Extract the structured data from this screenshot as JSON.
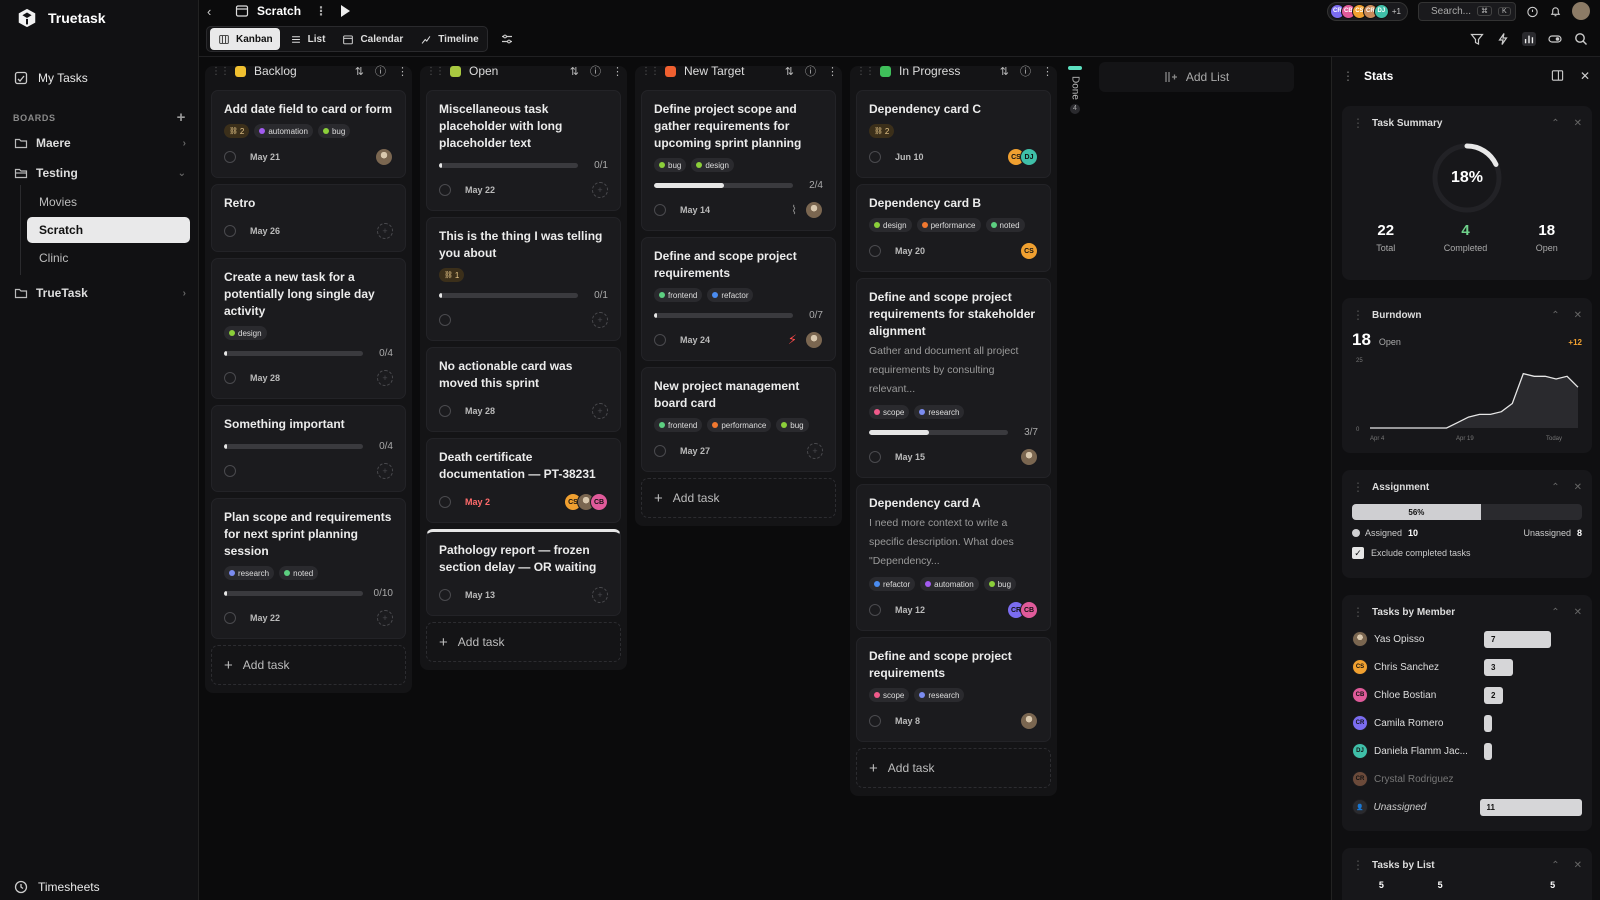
{
  "app": {
    "name": "Truetask"
  },
  "sidebar": {
    "my_tasks": "My Tasks",
    "boards_label": "BOARDS",
    "boards": [
      {
        "name": "Maere"
      },
      {
        "name": "Testing",
        "children": [
          "Movies",
          "Scratch",
          "Clinic"
        ]
      },
      {
        "name": "TrueTask"
      }
    ],
    "timesheets": "Timesheets"
  },
  "topbar": {
    "board_title": "Scratch",
    "search_placeholder": "Search...",
    "kbd1": "⌘",
    "kbd2": "K",
    "avatars": [
      {
        "initials": "CR",
        "color": "#7b6cf0"
      },
      {
        "initials": "CB",
        "color": "#e05a9a"
      },
      {
        "initials": "CS",
        "color": "#f0a030"
      },
      {
        "initials": "CR",
        "color": "#c98b5a"
      },
      {
        "initials": "DJ",
        "color": "#3fbfa8"
      }
    ],
    "avatar_more": "+1"
  },
  "views": {
    "tabs": [
      {
        "label": "Kanban",
        "active": true
      },
      {
        "label": "List"
      },
      {
        "label": "Calendar"
      },
      {
        "label": "Timeline"
      }
    ]
  },
  "columns": [
    {
      "name": "Backlog",
      "color": "#f0c030",
      "cards": [
        {
          "title": "Add date field to card or form",
          "dep": "2",
          "tags": [
            {
              "label": "automation",
              "color": "#a25bf0"
            },
            {
              "label": "bug",
              "color": "#8bcf3a"
            }
          ],
          "date": "May 21",
          "avatars": [
            "photo"
          ]
        },
        {
          "title": "Retro",
          "date": "May 26",
          "ghost": true
        },
        {
          "title": "Create a new task for a potentially long single day activity",
          "tags": [
            {
              "label": "design",
              "color": "#8bcf3a"
            }
          ],
          "progress": {
            "done": 0,
            "total": 4,
            "label": "0/4"
          },
          "date": "May 28",
          "ghost": true
        },
        {
          "title": "Something important",
          "progress": {
            "done": 0,
            "total": 4,
            "label": "0/4"
          },
          "ghost": true
        },
        {
          "title": "Plan scope and requirements for next sprint planning session",
          "tags": [
            {
              "label": "research",
              "color": "#7b8cf0"
            },
            {
              "label": "noted",
              "color": "#5ccf80"
            }
          ],
          "progress": {
            "done": 0,
            "total": 10,
            "label": "0/10"
          },
          "date": "May 22",
          "ghost": true
        }
      ],
      "add_label": "Add task"
    },
    {
      "name": "Open",
      "color": "#a8c840",
      "cards": [
        {
          "title": "Miscellaneous task placeholder with long placeholder text",
          "progress": {
            "done": 0,
            "total": 1,
            "label": "0/1"
          },
          "date": "May 22",
          "ghost": true
        },
        {
          "title": "This is the thing I was telling you about",
          "dep": "1",
          "progress": {
            "done": 0,
            "total": 1,
            "label": "0/1"
          },
          "ghost": true
        },
        {
          "title": "No actionable card was moved this sprint",
          "date": "May 28",
          "ghost": true
        },
        {
          "title": "Death certificate documentation — PT-38231",
          "date": "May 2",
          "due": true,
          "avatars": [
            "CS",
            "photo",
            "CB"
          ]
        },
        {
          "title": "Pathology report — frozen section delay — OR waiting",
          "date": "May 13",
          "ghost": true,
          "topline": true
        }
      ],
      "add_label": "Add task"
    },
    {
      "name": "New Target",
      "color": "#f06030",
      "cards": [
        {
          "title": "Define project scope and gather requirements for upcoming sprint planning",
          "tags": [
            {
              "label": "bug",
              "color": "#8bcf3a"
            },
            {
              "label": "design",
              "color": "#8bcf3a"
            }
          ],
          "progress": {
            "done": 2,
            "total": 4,
            "label": "2/4"
          },
          "date": "May 14",
          "attach": true,
          "avatars": [
            "photo"
          ]
        },
        {
          "title": "Define and scope project requirements",
          "tags": [
            {
              "label": "frontend",
              "color": "#5ccf80"
            },
            {
              "label": "refactor",
              "color": "#4a8cf0"
            }
          ],
          "progress": {
            "done": 0,
            "total": 7,
            "label": "0/7"
          },
          "date": "May 24",
          "bolt": true,
          "avatars": [
            "photo"
          ]
        },
        {
          "title": "New project management board card",
          "tags": [
            {
              "label": "frontend",
              "color": "#5ccf80"
            },
            {
              "label": "performance",
              "color": "#f07830"
            },
            {
              "label": "bug",
              "color": "#8bcf3a"
            }
          ],
          "date": "May 27",
          "ghost": true
        }
      ],
      "add_label": "Add task"
    },
    {
      "name": "In Progress",
      "color": "#3fbf5a",
      "cards": [
        {
          "title": "Dependency card C",
          "dep": "2",
          "date": "Jun 10",
          "avatars": [
            "CS",
            "DJ"
          ]
        },
        {
          "title": "Dependency card B",
          "tags": [
            {
              "label": "design",
              "color": "#8bcf3a"
            },
            {
              "label": "performance",
              "color": "#f07830"
            },
            {
              "label": "noted",
              "color": "#5ccf80"
            }
          ],
          "date": "May 20",
          "avatars": [
            "CS"
          ]
        },
        {
          "title": "Define and scope project requirements for stakeholder alignment",
          "desc": "Gather and document all project requirements by consulting relevant...",
          "tags": [
            {
              "label": "scope",
              "color": "#f05a8a"
            },
            {
              "label": "research",
              "color": "#7b8cf0"
            }
          ],
          "progress": {
            "done": 3,
            "total": 7,
            "label": "3/7"
          },
          "date": "May 15",
          "avatars": [
            "photo"
          ]
        },
        {
          "title": "Dependency card A",
          "desc": "I need more context to write a specific description. What does \"Dependency...",
          "tags": [
            {
              "label": "refactor",
              "color": "#4a8cf0"
            },
            {
              "label": "automation",
              "color": "#a25bf0"
            },
            {
              "label": "bug",
              "color": "#8bcf3a"
            }
          ],
          "date": "May 12",
          "avatars": [
            "CR",
            "CB"
          ]
        },
        {
          "title": "Define and scope project requirements",
          "tags": [
            {
              "label": "scope",
              "color": "#f05a8a"
            },
            {
              "label": "research",
              "color": "#7b8cf0"
            }
          ],
          "date": "May 8",
          "avatars": [
            "photo"
          ]
        }
      ],
      "add_label": "Add task"
    }
  ],
  "done": {
    "label": "Done",
    "count": "4"
  },
  "add_list": "Add List",
  "stats": {
    "title": "Stats",
    "summary": {
      "title": "Task Summary",
      "percent": 18,
      "percent_label": "18%",
      "total": "22",
      "total_label": "Total",
      "completed": "4",
      "completed_label": "Completed",
      "open": "18",
      "open_label": "Open"
    },
    "burndown": {
      "title": "Burndown",
      "open": "18",
      "open_label": "Open",
      "delta": "+12",
      "y_tick": "25",
      "y_zero": "0",
      "x_labels": [
        "Apr 4",
        "Apr 19",
        "Today"
      ],
      "values": [
        0,
        0,
        0,
        0,
        0,
        0,
        0,
        0,
        2,
        4,
        5,
        5,
        6,
        9,
        20,
        19,
        19,
        18,
        19,
        15
      ]
    },
    "assignment": {
      "title": "Assignment",
      "percent": 56,
      "percent_label": "56%",
      "assigned_label": "Assigned",
      "assigned": "10",
      "unassigned_label": "Unassigned",
      "unassigned": "8",
      "exclude_label": "Exclude completed tasks"
    },
    "members": {
      "title": "Tasks by Member",
      "rows": [
        {
          "name": "Yas Opisso",
          "count": 7,
          "label": "7",
          "photo": true
        },
        {
          "name": "Chris Sanchez",
          "count": 3,
          "label": "3",
          "initials": "CS",
          "color": "#f0a030"
        },
        {
          "name": "Chloe Bostian",
          "count": 2,
          "label": "2",
          "initials": "CB",
          "color": "#e05a9a"
        },
        {
          "name": "Camila Romero",
          "count": 0.6,
          "label": "",
          "initials": "CR",
          "color": "#7b6cf0"
        },
        {
          "name": "Daniela Flamm Jac...",
          "count": 0.6,
          "label": "",
          "initials": "DJ",
          "color": "#3fbfa8"
        },
        {
          "name": "Crystal Rodriguez",
          "count": 0,
          "label": "",
          "initials": "CR",
          "color": "#6b4a3a",
          "dim": true
        },
        {
          "name": "Unassigned",
          "count": 11,
          "label": "11",
          "unassigned": true
        }
      ]
    },
    "lists": {
      "title": "Tasks by List",
      "values": [
        "5",
        "5",
        "",
        "5"
      ]
    }
  },
  "colors": {
    "accent": "#e9e9ea",
    "bg": "#0b0b0c",
    "card": "#1b1b1e"
  }
}
